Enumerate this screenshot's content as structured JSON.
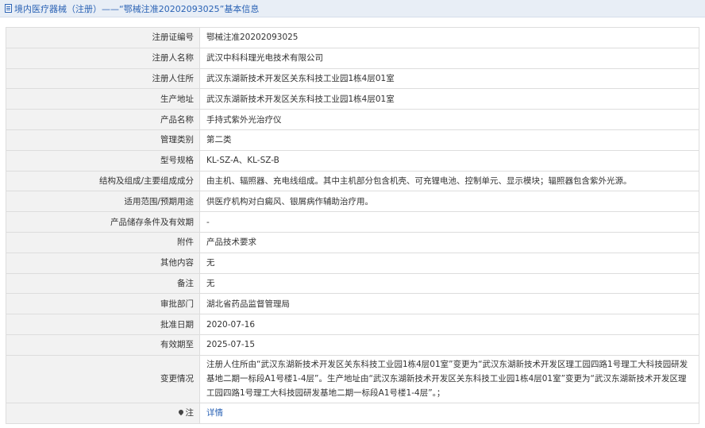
{
  "header": {
    "title": "境内医疗器械（注册）——“鄂械注准20202093025”基本信息"
  },
  "rows": [
    {
      "label": "注册证编号",
      "value": "鄂械注准20202093025"
    },
    {
      "label": "注册人名称",
      "value": "武汉中科科理光电技术有限公司"
    },
    {
      "label": "注册人住所",
      "value": "武汉东湖新技术开发区关东科技工业园1栋4层01室"
    },
    {
      "label": "生产地址",
      "value": "武汉东湖新技术开发区关东科技工业园1栋4层01室"
    },
    {
      "label": "产品名称",
      "value": "手持式紫外光治疗仪"
    },
    {
      "label": "管理类别",
      "value": "第二类"
    },
    {
      "label": "型号规格",
      "value": "KL-SZ-A、KL-SZ-B"
    },
    {
      "label": "结构及组成/主要组成成分",
      "value": "由主机、辐照器、充电线组成。其中主机部分包含机壳、可充锂电池、控制单元、显示模块；辐照器包含紫外光源。"
    },
    {
      "label": "适用范围/预期用途",
      "value": "供医疗机构对白癜风、银屑病作辅助治疗用。"
    },
    {
      "label": "产品储存条件及有效期",
      "value": "-"
    },
    {
      "label": "附件",
      "value": "产品技术要求"
    },
    {
      "label": "其他内容",
      "value": "无"
    },
    {
      "label": "备注",
      "value": "无"
    },
    {
      "label": "审批部门",
      "value": "湖北省药品监督管理局"
    },
    {
      "label": "批准日期",
      "value": "2020-07-16"
    },
    {
      "label": "有效期至",
      "value": "2025-07-15"
    }
  ],
  "change": {
    "label": "变更情况",
    "value": "注册人住所由“武汉东湖新技术开发区关东科技工业园1栋4层01室”变更为“武汉东湖新技术开发区理工园四路1号理工大科技园研发基地二期一标段A1号楼1-4层”。生产地址由“武汉东湖新技术开发区关东科技工业园1栋4层01室”变更为“武汉东湖新技术开发区理工园四路1号理工大科技园研发基地二期一标段A1号楼1-4层”。；"
  },
  "note": {
    "label": "注",
    "icon": "pin-icon",
    "link": "详情"
  }
}
